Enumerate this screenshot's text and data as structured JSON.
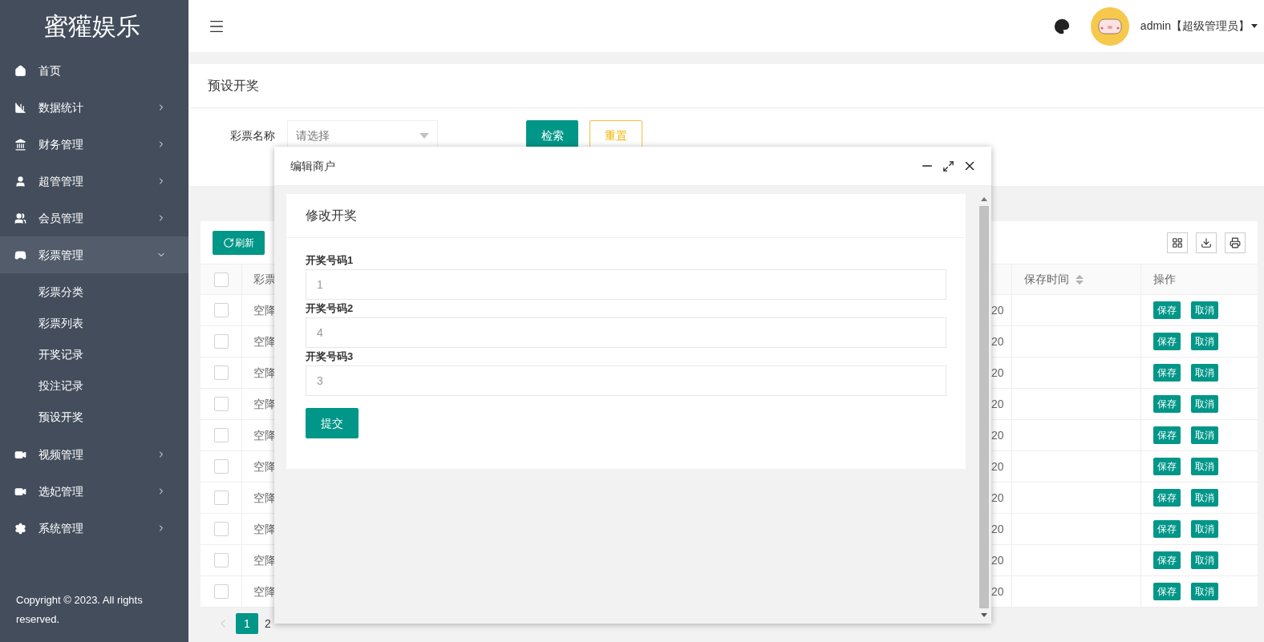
{
  "sidebar": {
    "logo": "蜜獾娱乐",
    "items": [
      {
        "label": "首页"
      },
      {
        "label": "数据统计",
        "expanded": false
      },
      {
        "label": "财务管理",
        "expanded": false
      },
      {
        "label": "超管管理",
        "expanded": false
      },
      {
        "label": "会员管理",
        "expanded": false
      },
      {
        "label": "彩票管理",
        "expanded": true,
        "children": [
          {
            "label": "彩票分类"
          },
          {
            "label": "彩票列表"
          },
          {
            "label": "开奖记录"
          },
          {
            "label": "投注记录"
          },
          {
            "label": "预设开奖"
          }
        ]
      },
      {
        "label": "视频管理",
        "expanded": false
      },
      {
        "label": "选妃管理",
        "expanded": false
      },
      {
        "label": "系统管理",
        "expanded": false
      }
    ],
    "copyright": "Copyright © 2023. All rights reserved."
  },
  "header": {
    "user": "admin【超级管理员】"
  },
  "breadcrumb": "预设开奖",
  "search": {
    "label": "彩票名称",
    "select": {
      "placeholder": "请选择"
    },
    "buttons": [
      "检索",
      "重置"
    ]
  },
  "table": {
    "refresh": "刷新",
    "all_checked": false,
    "columns": [
      {
        "label": "彩票"
      },
      {
        "label": "保存时间",
        "sortable": true
      },
      {
        "label": "操作"
      }
    ],
    "rows": [
      {
        "name": "空降",
        "column_3": "20",
        "checked": false,
        "actions": [
          "保存",
          "取消"
        ]
      },
      {
        "name": "空降",
        "column_3": "20",
        "checked": false,
        "actions": [
          "保存",
          "取消"
        ]
      },
      {
        "name": "空降",
        "column_3": "20",
        "checked": false,
        "actions": [
          "保存",
          "取消"
        ]
      },
      {
        "name": "空降",
        "column_3": "20",
        "checked": false,
        "actions": [
          "保存",
          "取消"
        ]
      },
      {
        "name": "空降",
        "column_3": "20",
        "checked": false,
        "actions": [
          "保存",
          "取消"
        ]
      },
      {
        "name": "空降",
        "column_3": "20",
        "checked": false,
        "actions": [
          "保存",
          "取消"
        ]
      },
      {
        "name": "空降",
        "column_3": "20",
        "checked": false,
        "actions": [
          "保存",
          "取消"
        ]
      },
      {
        "name": "空降",
        "column_3": "20",
        "checked": false,
        "actions": [
          "保存",
          "取消"
        ]
      },
      {
        "name": "空降",
        "column_3": "20",
        "checked": false,
        "actions": [
          "保存",
          "取消"
        ]
      },
      {
        "name": "空降",
        "column_3": "20",
        "checked": false,
        "actions": [
          "保存",
          "取消"
        ]
      }
    ],
    "pagination": {
      "prev_disabled": true,
      "pages": [
        {
          "label": "1",
          "selected": true
        },
        {
          "label": "2",
          "selected": false
        }
      ]
    }
  },
  "modal": {
    "title": "编辑商户",
    "card_title": "修改开奖",
    "fields": [
      {
        "label": "开奖号码1",
        "placeholder": "1"
      },
      {
        "label": "开奖号码2",
        "placeholder": "4"
      },
      {
        "label": "开奖号码3",
        "placeholder": "3"
      }
    ],
    "submit": "提交"
  }
}
